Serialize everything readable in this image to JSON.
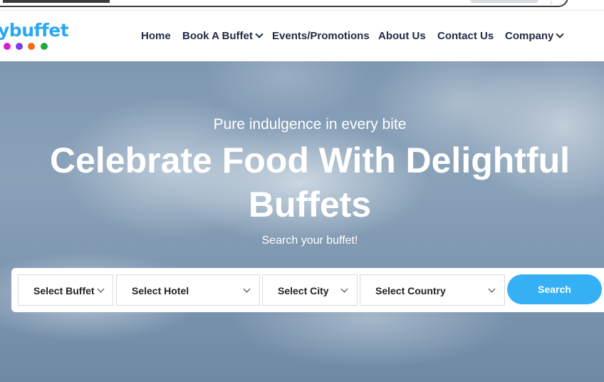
{
  "brand": {
    "logo_text": "ybuffet",
    "dot_colors": [
      "#d81fd0",
      "#7b3fe4",
      "#f26b1d",
      "#22a845"
    ],
    "accent": "#35b0f5"
  },
  "nav": {
    "items": [
      {
        "label": "Home",
        "has_dropdown": false
      },
      {
        "label": "Book A Buffet",
        "has_dropdown": true
      },
      {
        "label": "Events/Promotions",
        "has_dropdown": false
      },
      {
        "label": "About Us",
        "has_dropdown": false
      },
      {
        "label": "Contact Us",
        "has_dropdown": false
      },
      {
        "label": "Company",
        "has_dropdown": true
      }
    ]
  },
  "hero": {
    "tagline": "Pure indulgence in every bite",
    "title": "Celebrate Food With Delightful Buffets",
    "subtitle": "Search your buffet!"
  },
  "search": {
    "selects": [
      {
        "label": "Select Buffet"
      },
      {
        "label": "Select Hotel"
      },
      {
        "label": "Select City"
      },
      {
        "label": "Select Country"
      }
    ],
    "button_label": "Search"
  }
}
